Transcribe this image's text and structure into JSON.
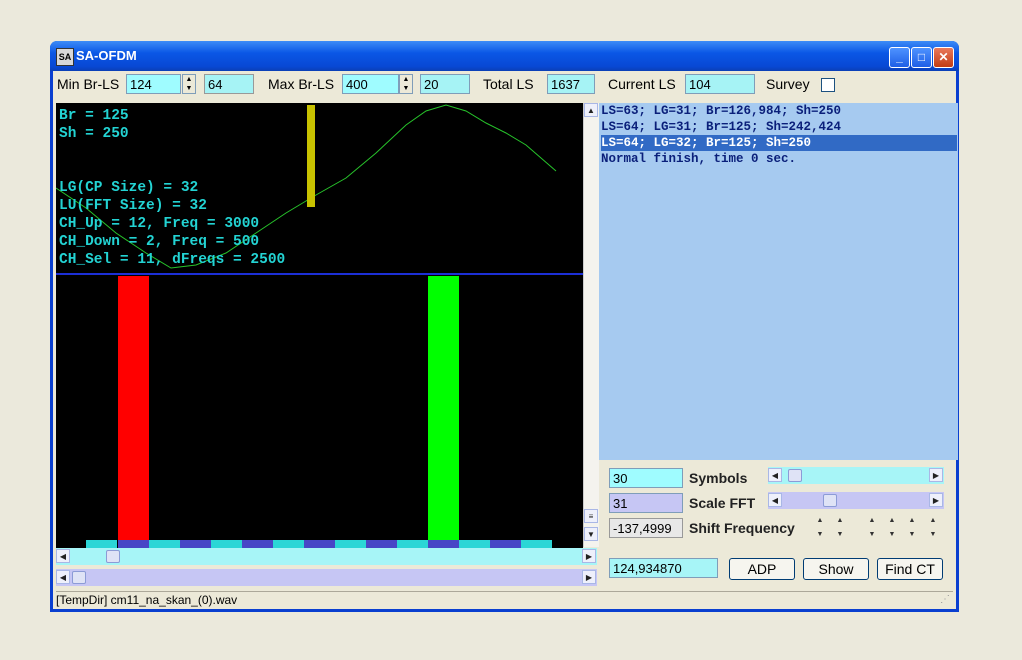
{
  "window": {
    "title": "SA-OFDM",
    "icon_label": "SA"
  },
  "toolbar": {
    "min_label": "Min Br-LS",
    "min_value": "124",
    "min_step": "64",
    "max_label": "Max Br-LS",
    "max_value": "400",
    "max_step": "20",
    "total_label": "Total LS",
    "total_value": "1637",
    "current_label": "Current LS",
    "current_value": "104",
    "survey_label": "Survey",
    "survey_checked": false
  },
  "scope": {
    "lines": [
      "Br = 125",
      "Sh = 250",
      "",
      "",
      "LG(CP Size) = 32",
      "LU(FFT Size) = 32",
      "CH_Up = 12, Freq = 3000",
      "CH_Down = 2, Freq = 500",
      "CH_Sel = 11, dFreqs = 2500"
    ]
  },
  "log": {
    "items": [
      {
        "text": "LS=63; LG=31; Br=126,984; Sh=250",
        "selected": false
      },
      {
        "text": "LS=64; LG=31; Br=125; Sh=242,424",
        "selected": false
      },
      {
        "text": "LS=64; LG=32; Br=125; Sh=250",
        "selected": true
      },
      {
        "text": "Normal finish, time 0 sec.",
        "selected": false
      }
    ]
  },
  "controls": {
    "symbols_value": "30",
    "symbols_label": "Symbols",
    "scale_value": "31",
    "scale_label": "Scale FFT",
    "shift_value": "-137,4999",
    "shift_label": "Shift Frequency",
    "freq_value": "124,934870"
  },
  "buttons": {
    "adp": "ADP",
    "show": "Show",
    "find": "Find CT"
  },
  "status": {
    "text": "[TempDir] cm11_na_skan_(0).wav"
  },
  "colors": {
    "scope_text": "#23d3d3",
    "bar_red": "#ff0000",
    "bar_green": "#00ff00",
    "marker": "#c8c200",
    "field": "#9ffcff"
  }
}
